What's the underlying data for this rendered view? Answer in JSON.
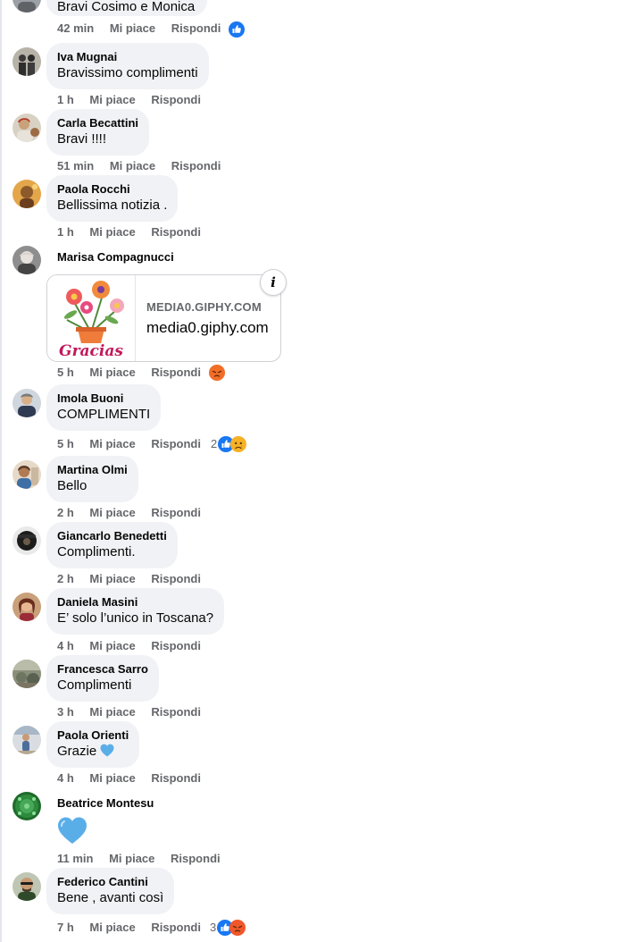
{
  "colors": {
    "bubble": "#f0f2f5",
    "meta": "#65676b",
    "like_blue": "#1877f2",
    "angry": "#f0572a",
    "heart": "#5aaee8"
  },
  "actions": {
    "like": "Mi piace",
    "reply": "Rispondi"
  },
  "comments": [
    {
      "author": "",
      "text": "Bravi Cosimo e Monica",
      "time": "42 min",
      "reactions": {
        "count": "",
        "icons": [
          "like-icon"
        ]
      }
    },
    {
      "author": "Iva Mugnai",
      "text": "Bravissimo complimenti",
      "time": "1 h"
    },
    {
      "author": "Carla Becattini",
      "text": "Bravi !!!!",
      "time": "51 min"
    },
    {
      "author": "Paola Rocchi",
      "text": "Bellissima notizia .",
      "time": "1 h"
    },
    {
      "author": "Marisa Compagnucci",
      "text": "",
      "time": "5 h",
      "link": {
        "domain": "MEDIA0.GIPHY.COM",
        "title": "media0.giphy.com",
        "thumb_text": "Gracias"
      },
      "reactions": {
        "count": "",
        "icons": [
          "angry-icon"
        ]
      }
    },
    {
      "author": "Imola Buoni",
      "text": "COMPLIMENTI",
      "time": "5 h",
      "reactions": {
        "count": "2",
        "icons": [
          "like-icon",
          "sad-icon"
        ]
      }
    },
    {
      "author": "Martina Olmi",
      "text": "Bello",
      "time": "2 h"
    },
    {
      "author": "Giancarlo Benedetti",
      "text": "Complimenti.",
      "time": "2 h"
    },
    {
      "author": "Daniela Masini",
      "text": "E’ solo l’unico in Toscana?",
      "time": "4 h"
    },
    {
      "author": "Francesca Sarro",
      "text": "Complimenti",
      "time": "3 h"
    },
    {
      "author": "Paola Orienti",
      "text": "Grazie",
      "time": "4 h",
      "emoji": "blue-heart-icon"
    },
    {
      "author": "Beatrice Montesu",
      "text": "",
      "time": "11 min",
      "emoji": "blue-heart-icon"
    },
    {
      "author": "Federico Cantini",
      "text": "Bene , avanti così",
      "time": "7 h",
      "reactions": {
        "count": "3",
        "icons": [
          "like-icon",
          "angry-icon"
        ]
      }
    }
  ]
}
